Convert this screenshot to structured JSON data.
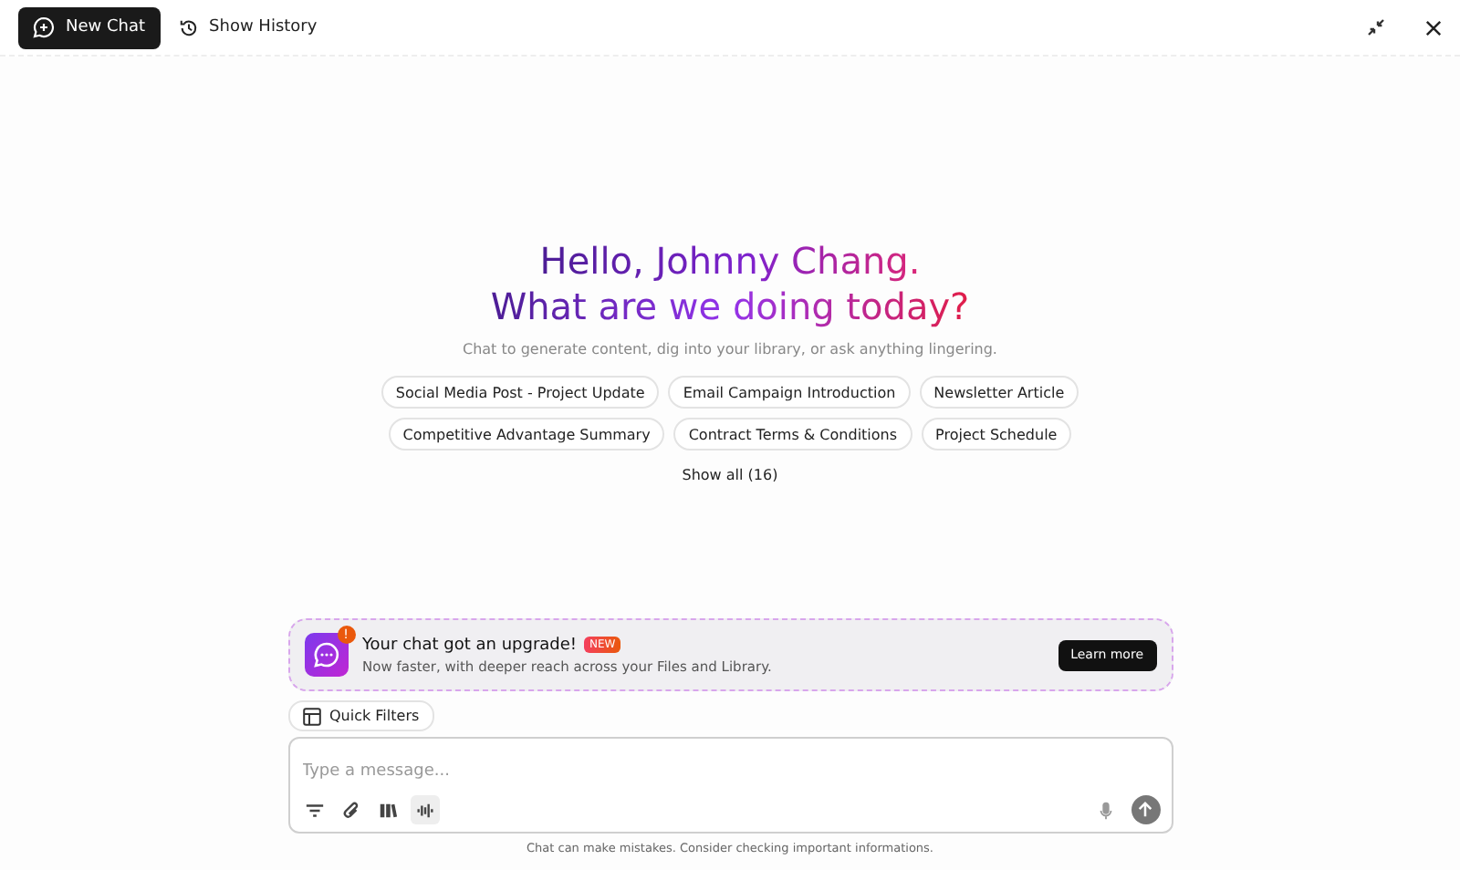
{
  "topbar": {
    "new_chat": "New Chat",
    "history": "Show History"
  },
  "greeting": {
    "line1": "Hello, Johnny Chang.",
    "line2": "What are we doing today?",
    "subtitle": "Chat to generate content, dig into your library, or ask anything lingering."
  },
  "suggestions": [
    [
      "Social Media Post - Project Update",
      "Email Campaign Introduction",
      "Newsletter Article"
    ],
    [
      "Competitive Advantage Summary",
      "Contract Terms & Conditions",
      "Project Schedule"
    ]
  ],
  "show_all": "Show all (16)",
  "banner": {
    "title": "Your chat got an upgrade!",
    "badge": "NEW",
    "text": "Now faster, with deeper reach across your Files and Library.",
    "button": "Learn more",
    "notification": "!"
  },
  "quick_filters": "Quick Filters",
  "composer": {
    "placeholder": "Type a message...",
    "tools": [
      {
        "kind": "filter",
        "selected": false
      },
      {
        "kind": "attach",
        "selected": false
      },
      {
        "kind": "library",
        "selected": false
      },
      {
        "kind": "voice",
        "selected": true
      }
    ]
  },
  "disclaimer": "Chat can make mistakes. Consider checking important informations."
}
